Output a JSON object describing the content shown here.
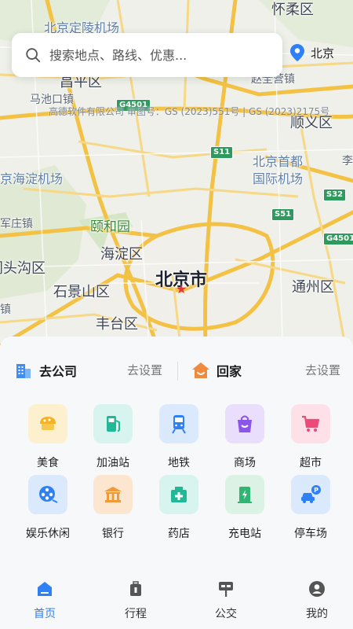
{
  "search": {
    "placeholder": "搜索地点、路线、优惠..."
  },
  "location": {
    "city": "北京"
  },
  "map": {
    "copyright": "高德软件有限公司 审图号：GS (2023)551号 | GS (2023)2175号",
    "labels": [
      {
        "text": "怀柔区",
        "kind": "district"
      },
      {
        "text": "北京定陵机场",
        "kind": "airport"
      },
      {
        "text": "昌平区",
        "kind": "district"
      },
      {
        "text": "赵全营镇",
        "kind": "town"
      },
      {
        "text": "马池口镇",
        "kind": "town"
      },
      {
        "text": "顺义区",
        "kind": "district"
      },
      {
        "text": "北京首都",
        "kind": "airport"
      },
      {
        "text": "国际机场",
        "kind": "airport"
      },
      {
        "text": "京海淀机场",
        "kind": "airport"
      },
      {
        "text": "军庄镇",
        "kind": "town"
      },
      {
        "text": "颐和园",
        "kind": "park"
      },
      {
        "text": "海淀区",
        "kind": "district"
      },
      {
        "text": "门头沟区",
        "kind": "district"
      },
      {
        "text": "北京市",
        "kind": "city"
      },
      {
        "text": "石景山区",
        "kind": "district"
      },
      {
        "text": "通州区",
        "kind": "district"
      },
      {
        "text": "丰台区",
        "kind": "district"
      },
      {
        "text": "镇",
        "kind": "town"
      },
      {
        "text": "李",
        "kind": "town"
      }
    ],
    "shields": [
      "G4501",
      "S11",
      "S32",
      "S51",
      "G4501"
    ]
  },
  "quick": {
    "company": {
      "label": "去公司",
      "action": "去设置"
    },
    "home": {
      "label": "回家",
      "action": "去设置"
    }
  },
  "grid": [
    {
      "label": "美食",
      "icon": "food-icon"
    },
    {
      "label": "加油站",
      "icon": "gas-station-icon"
    },
    {
      "label": "地铁",
      "icon": "subway-icon"
    },
    {
      "label": "商场",
      "icon": "mall-icon"
    },
    {
      "label": "超市",
      "icon": "supermarket-icon"
    },
    {
      "label": "娱乐休闲",
      "icon": "entertainment-icon"
    },
    {
      "label": "银行",
      "icon": "bank-icon"
    },
    {
      "label": "药店",
      "icon": "pharmacy-icon"
    },
    {
      "label": "充电站",
      "icon": "charging-station-icon"
    },
    {
      "label": "停车场",
      "icon": "parking-icon"
    }
  ],
  "nav": [
    {
      "label": "首页",
      "icon": "home-icon",
      "active": true
    },
    {
      "label": "行程",
      "icon": "luggage-icon",
      "active": false
    },
    {
      "label": "公交",
      "icon": "bus-stop-icon",
      "active": false
    },
    {
      "label": "我的",
      "icon": "profile-icon",
      "active": false
    }
  ],
  "colors": {
    "accent": "#2f7ff5",
    "road": "#f6c344",
    "home": "#f08a3c"
  }
}
